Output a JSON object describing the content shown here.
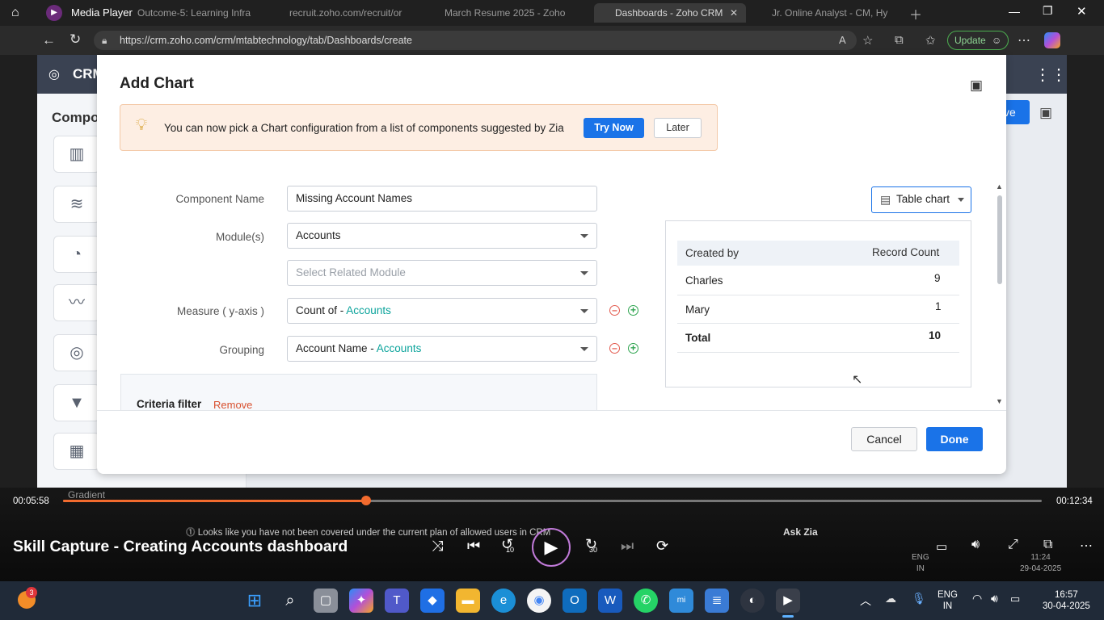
{
  "player_title_bar": {
    "app_name": "Media Player",
    "tabs": [
      {
        "label": "Outcome-5: Learning Infra"
      },
      {
        "label": "recruit.zoho.com/recruit/or"
      },
      {
        "label": "March Resume 2025 - Zoho"
      },
      {
        "label": "Dashboards - Zoho CRM"
      },
      {
        "label": "Jr. Online Analyst - CM, Hy"
      }
    ]
  },
  "browser": {
    "url": "https://crm.zoho.com/crm/mtabtechnology/tab/Dashboards/create",
    "update_label": "Update"
  },
  "crm_bg": {
    "logo_text": "CRM",
    "left_title": "Compo",
    "save_partial": "ve",
    "gradient_label": "Gradient"
  },
  "modal": {
    "title": "Add Chart",
    "banner": {
      "text": "You can now pick a Chart configuration from a list of components suggested by Zia",
      "try_now": "Try Now",
      "later": "Later"
    },
    "form": {
      "component_name_label": "Component Name",
      "component_name_value": "Missing Account Names",
      "modules_label": "Module(s)",
      "modules_value": "Accounts",
      "related_module_placeholder": "Select Related Module",
      "measure_label": "Measure ( y-axis )",
      "measure_prefix": "Count of - ",
      "measure_module": "Accounts",
      "grouping_label": "Grouping",
      "grouping_prefix": "Account Name - ",
      "grouping_module": "Accounts",
      "criteria_label": "Criteria filter",
      "remove_label": "Remove"
    },
    "chart_type": "Table chart",
    "preview_table": {
      "headers": [
        "Created by",
        "Record Count"
      ],
      "rows": [
        {
          "name": "Charles",
          "count": "9"
        },
        {
          "name": "Mary",
          "count": "1"
        }
      ],
      "total_label": "Total",
      "total_value": "10"
    },
    "cancel": "Cancel",
    "done": "Done"
  },
  "crm_footer": {
    "notice": "Looks like you have not been covered under the current plan of allowed users in CRM",
    "ask_zia": "Ask Zia"
  },
  "player": {
    "current_time": "00:05:58",
    "total_time": "00:12:34",
    "progress_fraction": 0.31,
    "video_title": "Skill Capture - Creating Accounts dashboard",
    "skip_back": "10",
    "skip_forward": "30"
  },
  "inner_taskbar": {
    "lang_line1": "ENG",
    "lang_line2": "IN",
    "time": "11:24",
    "date": "29-04-2025"
  },
  "taskbar": {
    "badge_count": "3",
    "lang_line1": "ENG",
    "lang_line2": "IN",
    "time": "16:57",
    "date": "30-04-2025"
  }
}
